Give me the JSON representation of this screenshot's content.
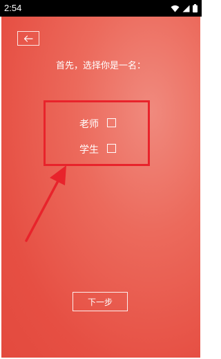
{
  "status_bar": {
    "time": "2:54",
    "icons": [
      "wifi-icon",
      "signal-icon",
      "battery-icon"
    ]
  },
  "screen": {
    "prompt": "首先，选择你是一名：",
    "roles": [
      {
        "label": "老师",
        "checked": false
      },
      {
        "label": "学生",
        "checked": false
      }
    ],
    "next_label": "下一步"
  },
  "annotation": {
    "highlight_color": "#e8232b",
    "arrow_color": "#e8232b"
  },
  "colors": {
    "background": "#e64f43",
    "highlight": "#f08a7e"
  }
}
